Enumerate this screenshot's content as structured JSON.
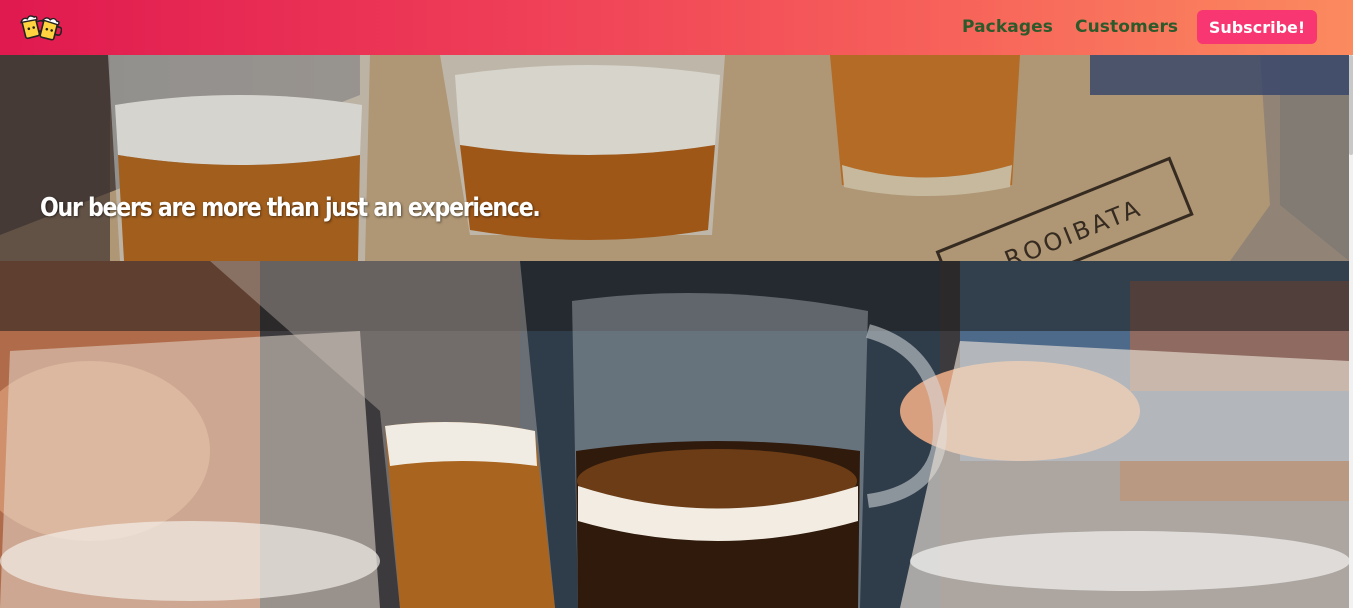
{
  "brand": {
    "logo_icon": "beer-mugs-icon",
    "nav_gradient": [
      "#e0194f",
      "#fb8a5f"
    ],
    "accent": "#f73672",
    "link_color": "#2c5a2a"
  },
  "nav": {
    "links": [
      {
        "label": "Packages"
      },
      {
        "label": "Customers"
      }
    ],
    "cta_label": "Subscribe!"
  },
  "hero": {
    "headline": "Our beers are more than just an experience.",
    "board_text": "ROOIBATA"
  },
  "photo": {
    "description": ""
  }
}
